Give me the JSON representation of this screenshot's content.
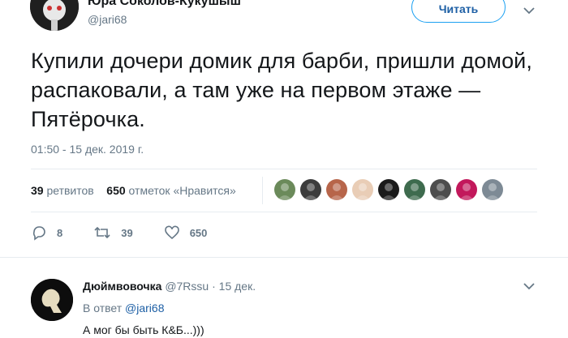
{
  "tweet": {
    "author_name": "Юра Соколов-Кукушыш",
    "author_handle": "@jari68",
    "follow_label": "Читать",
    "text": "Купили дочери домик для барби, пришли домой, распаковали, а там уже на первом этаже — Пятёрочка.",
    "timestamp": "01:50 - 15 дек. 2019 г."
  },
  "stats": {
    "retweets_count": "39",
    "retweets_label": "ретвитов",
    "likes_count": "650",
    "likes_label": "отметок «Нравится»"
  },
  "likers": [
    {
      "color": "#6b8a5a",
      "icon": "avatar"
    },
    {
      "color": "#3c3c3c",
      "icon": "avatar"
    },
    {
      "color": "#b7654a",
      "icon": "avatar"
    },
    {
      "color": "#e9cdb6",
      "icon": "avatar"
    },
    {
      "color": "#1b1b1b",
      "icon": "avatar"
    },
    {
      "color": "#3e6b4e",
      "icon": "avatar"
    },
    {
      "color": "#4d4d4d",
      "icon": "avatar"
    },
    {
      "color": "#c2185b",
      "icon": "avatar"
    },
    {
      "color": "#7d8a95",
      "icon": "avatar"
    }
  ],
  "actions": {
    "replies": "8",
    "retweets": "39",
    "likes": "650"
  },
  "reply": {
    "author_name": "Дюймвовочка",
    "author_handle": "@7Rssu",
    "separator": "·",
    "date": "15 дек.",
    "reply_to_prefix": "В ответ",
    "reply_to_handle": "@jari68",
    "text": "А мог бы быть К&Б...)))"
  },
  "colors": {
    "accent": "#1da1f2",
    "link": "#1d5fa5",
    "secondary": "#657786",
    "divider": "#e6ecf0"
  }
}
